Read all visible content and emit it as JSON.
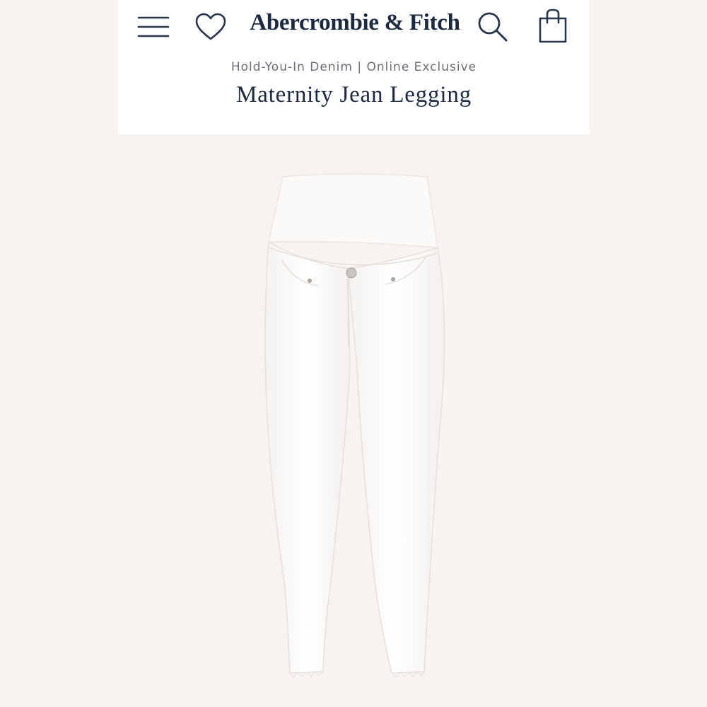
{
  "header": {
    "logo_text": "Abercrombie & Fitch",
    "icons": [
      "menu-icon",
      "heart-icon",
      "search-icon",
      "shopping-bag-icon"
    ],
    "icon_color": "#2b3548"
  },
  "product": {
    "subtitle": "Hold-You-In Denim | Online Exclusive",
    "title": "Maternity Jean Legging",
    "image_alt": "White maternity jean legging",
    "background_color": "#f8f3f1"
  }
}
